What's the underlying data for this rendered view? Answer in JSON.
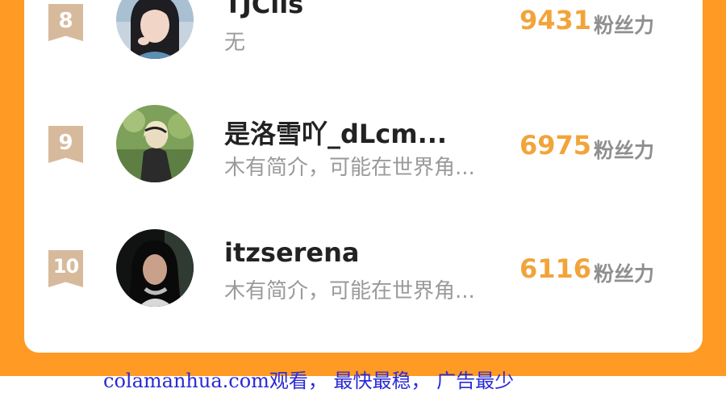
{
  "colors": {
    "background": "#ff9a24",
    "score": "#f2a43a",
    "rank_badge": "#d7b99c",
    "footer_link": "#2b2bd6"
  },
  "ranking": [
    {
      "rank": "8",
      "username": "TJClls",
      "bio": "无",
      "score": "9431",
      "score_unit": "粉丝力",
      "avatar": "avatar-woman-icon"
    },
    {
      "rank": "9",
      "username": "是洛雪吖_dLcm...",
      "bio": "木有简介，可能在世界角...",
      "score": "6975",
      "score_unit": "粉丝力",
      "avatar": "avatar-blonde-icon"
    },
    {
      "rank": "10",
      "username": "itzserena",
      "bio": "木有简介，可能在世界角...",
      "score": "6116",
      "score_unit": "粉丝力",
      "avatar": "avatar-dark-hair-icon"
    }
  ],
  "footer": {
    "ad_text": "colamanhua.com观看， 最快最稳， 广告最少"
  }
}
